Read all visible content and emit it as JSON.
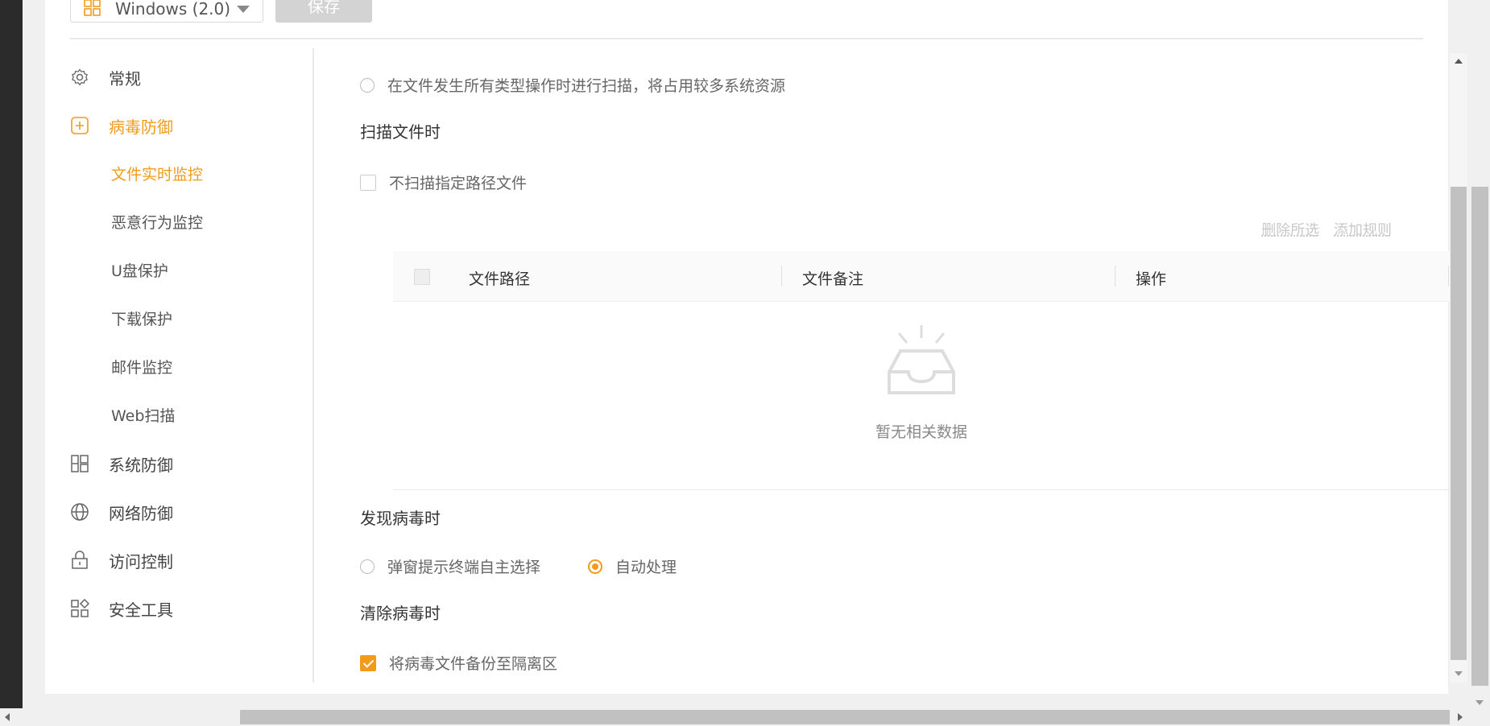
{
  "toolbar": {
    "os_select": "Windows (2.0)",
    "save_label": "保存"
  },
  "sidebar": {
    "items": [
      {
        "label": "常规",
        "icon": "gear-icon"
      },
      {
        "label": "病毒防御",
        "icon": "plus-square-icon"
      },
      {
        "label": "系统防御",
        "icon": "grid-icon"
      },
      {
        "label": "网络防御",
        "icon": "globe-icon"
      },
      {
        "label": "访问控制",
        "icon": "lock-icon"
      },
      {
        "label": "安全工具",
        "icon": "apps-icon"
      }
    ],
    "subitems": [
      {
        "label": "文件实时监控"
      },
      {
        "label": "恶意行为监控"
      },
      {
        "label": "U盘保护"
      },
      {
        "label": "下载保护"
      },
      {
        "label": "邮件监控"
      },
      {
        "label": "Web扫描"
      }
    ]
  },
  "content": {
    "scan_all_ops": "在文件发生所有类型操作时进行扫描，将占用较多系统资源",
    "scan_file_title": "扫描文件时",
    "skip_path_label": "不扫描指定路径文件",
    "delete_selected": "删除所选",
    "add_rule": "添加规则",
    "table": {
      "columns": [
        "文件路径",
        "文件备注",
        "操作"
      ],
      "empty_text": "暂无相关数据"
    },
    "found_virus_title": "发现病毒时",
    "popup_option": "弹窗提示终端自主选择",
    "auto_option": "自动处理",
    "clean_virus_title": "清除病毒时",
    "backup_option": "将病毒文件备份至隔离区"
  },
  "colors": {
    "accent": "#f29b1b",
    "muted": "#c8c8c8"
  }
}
